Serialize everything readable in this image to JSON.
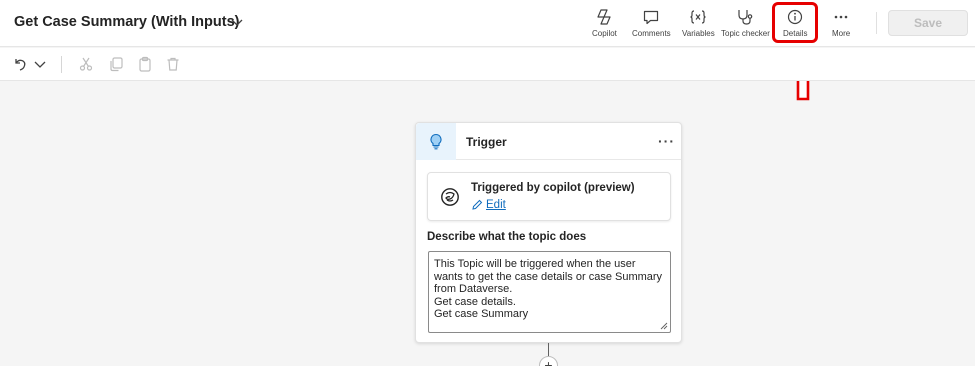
{
  "header": {
    "title": "Get Case Summary (With Inputs)",
    "tools": [
      {
        "id": "copilot",
        "label": "Copilot",
        "icon": "copilot-icon"
      },
      {
        "id": "comments",
        "label": "Comments",
        "icon": "comment-icon"
      },
      {
        "id": "variables",
        "label": "Variables",
        "icon": "variables-icon"
      },
      {
        "id": "topic_checker",
        "label": "Topic checker",
        "icon": "stethoscope-icon"
      },
      {
        "id": "details",
        "label": "Details",
        "icon": "info-icon"
      },
      {
        "id": "more",
        "label": "More",
        "icon": "more-icon"
      }
    ],
    "save_label": "Save",
    "highlight_color": "#e60000"
  },
  "toolbar": {
    "icons": [
      "undo-icon",
      "chevron-down-icon",
      "cut-icon",
      "copy-icon",
      "paste-icon",
      "delete-icon"
    ]
  },
  "card": {
    "title": "Trigger",
    "more_glyph": "···",
    "trigger": {
      "title": "Triggered by copilot (preview)",
      "edit_label": "Edit"
    },
    "description_label": "Describe what the topic does",
    "description_value": "This Topic will be triggered when the user wants to get the case details or case Summary from Dataverse.\nGet case details.\nGet case Summary"
  },
  "canvas": {
    "add_glyph": "+"
  },
  "colors": {
    "accent": "#0f6cbd",
    "trigger_icon_bg": "#e8f3fc",
    "canvas_bg": "#f5f5f5"
  }
}
